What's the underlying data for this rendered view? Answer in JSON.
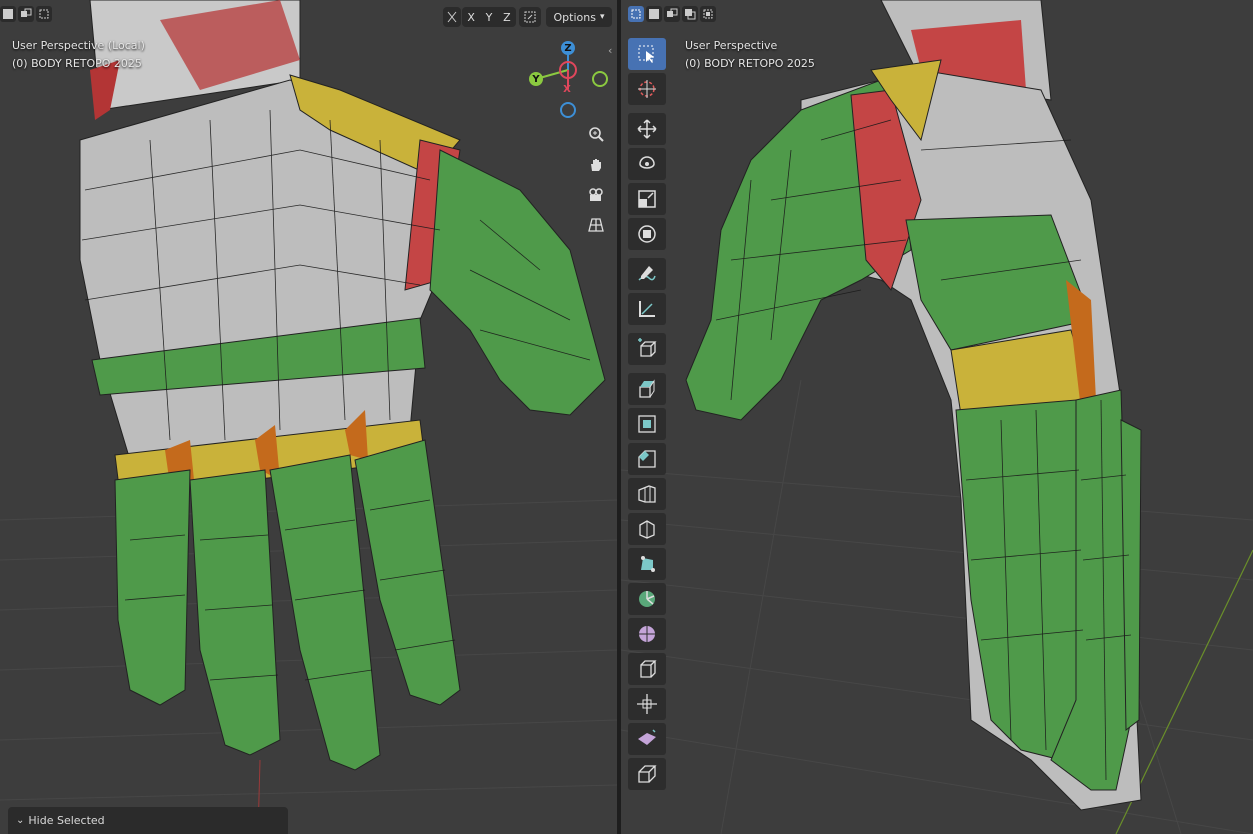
{
  "left_viewport": {
    "view_name": "User Perspective (Local)",
    "object_name": "(0) BODY RETOPO 2025",
    "header": {
      "axes": [
        "X",
        "Y",
        "Z"
      ],
      "options_label": "Options"
    },
    "gizmo": {
      "z_label": "Z",
      "y_label": "Y",
      "x_label": "X"
    },
    "nav_icons": [
      "zoom-icon",
      "hand-pan-icon",
      "camera-icon",
      "grid-perspective-icon"
    ],
    "redo_panel": {
      "label": "Hide Selected"
    }
  },
  "right_viewport": {
    "view_name": "User Perspective",
    "object_name": "(0) BODY RETOPO 2025",
    "toolbar": [
      {
        "name": "select-box-tool",
        "active": true
      },
      {
        "name": "cursor-tool",
        "active": false
      },
      {
        "name": "move-tool",
        "active": false
      },
      {
        "name": "rotate-tool",
        "active": false
      },
      {
        "name": "scale-tool",
        "active": false
      },
      {
        "name": "transform-tool",
        "active": false
      },
      {
        "name": "annotate-tool",
        "active": false
      },
      {
        "name": "measure-tool",
        "active": false
      },
      {
        "name": "add-cube-tool",
        "active": false
      },
      {
        "name": "extrude-tool",
        "active": false
      },
      {
        "name": "inset-tool",
        "active": false
      },
      {
        "name": "bevel-tool",
        "active": false
      },
      {
        "name": "loop-cut-tool",
        "active": false
      },
      {
        "name": "knife-tool",
        "active": false
      },
      {
        "name": "poly-build-tool",
        "active": false
      },
      {
        "name": "spin-tool",
        "active": false
      },
      {
        "name": "smooth-tool",
        "active": false
      },
      {
        "name": "edge-slide-tool",
        "active": false
      },
      {
        "name": "shrink-fatten-tool",
        "active": false
      },
      {
        "name": "shear-tool",
        "active": false
      },
      {
        "name": "rip-tool",
        "active": false
      }
    ]
  },
  "colors": {
    "viewport_bg": "#3d3d3d",
    "mesh_gray": "#bdbdbd",
    "mesh_green": "#4f9a4a",
    "mesh_red": "#b83a3a",
    "mesh_yellow": "#c9b23a",
    "mesh_orange": "#c46a1c",
    "active_blue": "#4772b3",
    "axis_x": "#e0475c",
    "axis_y": "#8bc940",
    "axis_z": "#3d8fd6"
  }
}
